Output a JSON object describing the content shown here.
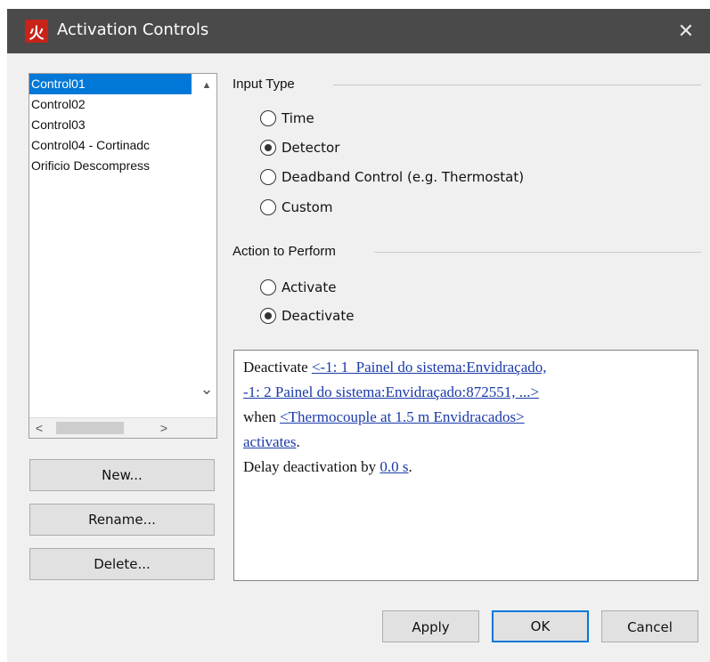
{
  "window": {
    "title": "Activation Controls",
    "app_icon_glyph": "火",
    "close_glyph": "✕"
  },
  "controls_list": {
    "items": [
      {
        "label": "Control01",
        "selected": true
      },
      {
        "label": "Control02",
        "selected": false
      },
      {
        "label": "Control03",
        "selected": false
      },
      {
        "label": "Control04 - Cortinadc",
        "selected": false
      },
      {
        "label": "Orificio Descompress",
        "selected": false
      }
    ],
    "scroll_up_glyph": "▲",
    "scroll_down_glyph": "⌄",
    "scroll_left_glyph": "<",
    "scroll_right_glyph": ">"
  },
  "side_buttons": {
    "new_label": "New...",
    "rename_label": "Rename...",
    "delete_label": "Delete..."
  },
  "input_type": {
    "title": "Input Type",
    "options": [
      {
        "label": "Time",
        "checked": false
      },
      {
        "label": "Detector",
        "checked": true
      },
      {
        "label": "Deadband Control (e.g. Thermostat)",
        "checked": false
      },
      {
        "label": "Custom",
        "checked": false
      }
    ]
  },
  "action": {
    "title": "Action to Perform",
    "options": [
      {
        "label": "Activate",
        "checked": false
      },
      {
        "label": "Deactivate",
        "checked": true
      }
    ]
  },
  "summary": {
    "prefix": "Deactivate ",
    "objects_link_line1": "<-1: 1_Painel do sistema:Envidraçado,",
    "objects_link_line2": "-1: 2 Painel do sistema:Envidraçado:872551, ...>",
    "when_text": "when ",
    "detector_link": "<Thermocouple at 1.5 m Envidracados>",
    "event_link": "activates",
    "period": ".",
    "delay_text": "Delay deactivation by ",
    "delay_link": "0.0 s",
    "delay_period": "."
  },
  "footer": {
    "apply_label": "Apply",
    "ok_label": "OK",
    "cancel_label": "Cancel"
  },
  "colors": {
    "titlebar": "#4a4a4a",
    "selection": "#0078d7",
    "link": "#1a3aa8",
    "app_icon": "#c7231a"
  }
}
